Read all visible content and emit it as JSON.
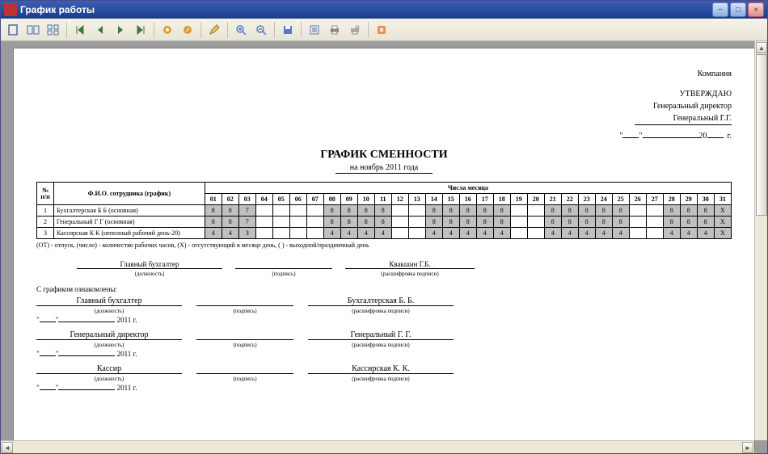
{
  "window": {
    "title": "График работы"
  },
  "header": {
    "company": "Компания",
    "approve": "УТВЕРЖДАЮ",
    "position": "Генеральный директор",
    "name": "Генеральный Г.Г.",
    "year_prefix": "20",
    "year_suffix": "г."
  },
  "doc": {
    "title": "ГРАФИК СМЕННОСТИ",
    "period": "на ноябрь 2011 года"
  },
  "table": {
    "col_num": "№ п/п",
    "col_name": "Ф.И.О. сотрудника (график)",
    "col_days_header": "Числа месяца",
    "days": [
      "01",
      "02",
      "03",
      "04",
      "05",
      "06",
      "07",
      "08",
      "09",
      "10",
      "11",
      "12",
      "13",
      "14",
      "15",
      "16",
      "17",
      "18",
      "19",
      "20",
      "21",
      "22",
      "23",
      "24",
      "25",
      "26",
      "27",
      "28",
      "29",
      "30",
      "31"
    ],
    "rows": [
      {
        "num": "1",
        "name": "Бухгалтерская Б Б (основная)",
        "cells": [
          "8",
          "8",
          "7",
          "",
          "",
          "",
          "",
          "8",
          "8",
          "8",
          "8",
          "",
          "",
          "8",
          "8",
          "8",
          "8",
          "8",
          "",
          "",
          "8",
          "8",
          "8",
          "8",
          "8",
          "",
          "",
          "8",
          "8",
          "8",
          "X"
        ]
      },
      {
        "num": "2",
        "name": "Генеральный Г Г (основная)",
        "cells": [
          "8",
          "8",
          "7",
          "",
          "",
          "",
          "",
          "8",
          "8",
          "8",
          "8",
          "",
          "",
          "8",
          "8",
          "8",
          "8",
          "8",
          "",
          "",
          "8",
          "8",
          "8",
          "8",
          "8",
          "",
          "",
          "8",
          "8",
          "8",
          "X"
        ]
      },
      {
        "num": "3",
        "name": "Кассирская К К (неполный рабочий день-20)",
        "cells": [
          "4",
          "4",
          "3",
          "",
          "",
          "",
          "",
          "4",
          "4",
          "4",
          "4",
          "",
          "",
          "4",
          "4",
          "4",
          "4",
          "4",
          "",
          "",
          "4",
          "4",
          "4",
          "4",
          "4",
          "",
          "",
          "4",
          "4",
          "4",
          "X"
        ]
      }
    ],
    "legend": "(ОТ) - отпуск, (число) - количество рабочих часов, (X) - отсутствующий в месяце день, ( ) - выходной/праздничный день"
  },
  "labels": {
    "position": "(должность)",
    "signature": "(подпись)",
    "decoded": "(расшифровка подписи)",
    "year": "2011 г.",
    "acquainted": "С графиком ознакомлены:"
  },
  "main_sign": {
    "position": "Главный бухгалтер",
    "name": "Квакшин Г.Б."
  },
  "ack": [
    {
      "position": "Главный бухгалтер",
      "name": "Бухгалтерская Б. Б."
    },
    {
      "position": "Генеральный директор",
      "name": "Генеральный Г. Г."
    },
    {
      "position": "Кассир",
      "name": "Кассирская К. К."
    }
  ]
}
